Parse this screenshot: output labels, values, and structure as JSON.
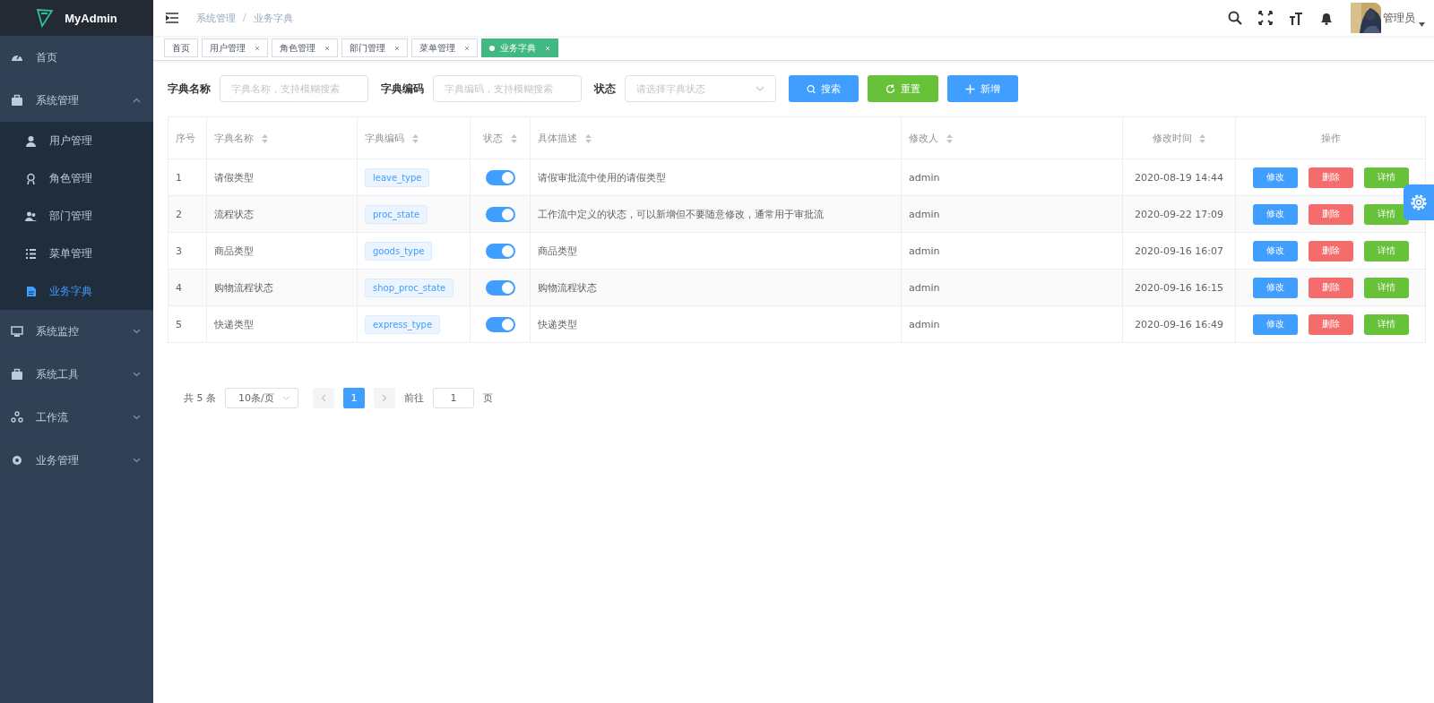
{
  "sidebar": {
    "logo": "MyAdmin",
    "items": [
      {
        "label": "首页",
        "selected": false
      },
      {
        "label": "系统管理",
        "expanded": true,
        "selected": false,
        "children": [
          {
            "label": "用户管理",
            "selected": false
          },
          {
            "label": "角色管理",
            "selected": false
          },
          {
            "label": "部门管理",
            "selected": false
          },
          {
            "label": "菜单管理",
            "selected": false
          },
          {
            "label": "业务字典",
            "selected": true
          }
        ]
      },
      {
        "label": "系统监控",
        "expanded": false,
        "selected": false
      },
      {
        "label": "系统工具",
        "expanded": false,
        "selected": false
      },
      {
        "label": "工作流",
        "expanded": false,
        "selected": false
      },
      {
        "label": "业务管理",
        "expanded": false,
        "selected": false
      }
    ]
  },
  "header": {
    "breadcrumb": [
      "系统管理",
      "业务字典"
    ],
    "breadcrumb_separator": "/",
    "user": "管理员"
  },
  "tabs": [
    {
      "label": "首页",
      "closable": false,
      "selected": false
    },
    {
      "label": "用户管理",
      "closable": true,
      "selected": false
    },
    {
      "label": "角色管理",
      "closable": true,
      "selected": false
    },
    {
      "label": "部门管理",
      "closable": true,
      "selected": false
    },
    {
      "label": "菜单管理",
      "closable": true,
      "selected": false
    },
    {
      "label": "业务字典",
      "closable": true,
      "selected": true
    }
  ],
  "filters": [
    {
      "label": "字典名称",
      "kind": "input",
      "placeholder": "字典名称，支持模糊搜索"
    },
    {
      "label": "字典编码",
      "kind": "input",
      "placeholder": "字典编码，支持模糊搜索"
    },
    {
      "label": "状态",
      "kind": "select",
      "placeholder": "请选择字典状态"
    }
  ],
  "buttons": [
    {
      "label": "搜索",
      "kind": "search"
    },
    {
      "label": "重置",
      "kind": "reset"
    },
    {
      "label": "新增",
      "kind": "add"
    }
  ],
  "table": {
    "columns": [
      {
        "label": "序号",
        "sortable": false
      },
      {
        "label": "字典名称",
        "sortable": true
      },
      {
        "label": "字典编码",
        "sortable": true
      },
      {
        "label": "状态",
        "sortable": true
      },
      {
        "label": "具体描述",
        "sortable": true
      },
      {
        "label": "修改人",
        "sortable": true
      },
      {
        "label": "修改时间",
        "sortable": true
      },
      {
        "label": "操作",
        "sortable": false
      }
    ],
    "rows": [
      {
        "index": "1",
        "name": "请假类型",
        "code": "leave_type",
        "enabled": true,
        "description": "请假审批流中使用的请假类型",
        "modifier": "admin",
        "time": "2020-08-19 14:44",
        "actions": [
          "修改",
          "删除",
          "详情"
        ]
      },
      {
        "index": "2",
        "name": "流程状态",
        "code": "proc_state",
        "enabled": true,
        "description": "工作流中定义的状态，可以新增但不要随意修改，通常用于审批流",
        "modifier": "admin",
        "time": "2020-09-22 17:09",
        "actions": [
          "修改",
          "删除",
          "详情"
        ]
      },
      {
        "index": "3",
        "name": "商品类型",
        "code": "goods_type",
        "enabled": true,
        "description": "商品类型",
        "modifier": "admin",
        "time": "2020-09-16 16:07",
        "actions": [
          "修改",
          "删除",
          "详情"
        ]
      },
      {
        "index": "4",
        "name": "购物流程状态",
        "code": "shop_proc_state",
        "enabled": true,
        "description": "购物流程状态",
        "modifier": "admin",
        "time": "2020-09-16 16:15",
        "actions": [
          "修改",
          "删除",
          "详情"
        ]
      },
      {
        "index": "5",
        "name": "快递类型",
        "code": "express_type",
        "enabled": true,
        "description": "快递类型",
        "modifier": "admin",
        "time": "2020-09-16 16:49",
        "actions": [
          "修改",
          "删除",
          "详情"
        ]
      }
    ]
  },
  "pagination": {
    "total": "共 5 条",
    "page_size": "10条/页",
    "pages": [
      {
        "label": "1",
        "selected": true
      }
    ],
    "jump_label": "前往",
    "jump_value": "1",
    "jump_suffix": "页"
  }
}
